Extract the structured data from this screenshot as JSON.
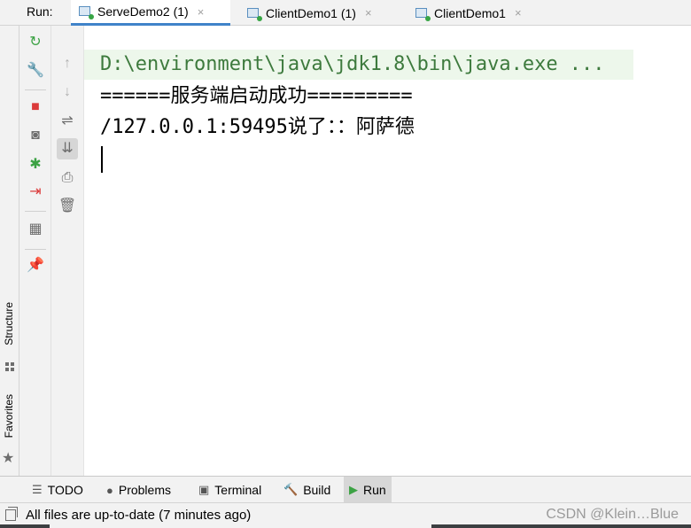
{
  "run_bar": {
    "label": "Run:",
    "tabs": [
      {
        "label": "ServeDemo2 (1)",
        "active": true
      },
      {
        "label": "ClientDemo1 (1)",
        "active": false
      },
      {
        "label": "ClientDemo1",
        "active": false
      }
    ],
    "close_glyph": "×"
  },
  "left_strip": {
    "structure_label": "Structure",
    "favorites_label": "Favorites"
  },
  "toolbar_1": [
    {
      "icon": "rerun-icon",
      "glyph": "↻",
      "color": "#3ca244"
    },
    {
      "icon": "wrench-icon",
      "glyph": "🔧",
      "color": "#6e6e6e"
    },
    {
      "icon": "stop-icon",
      "glyph": "■",
      "color": "#db3b3b"
    },
    {
      "icon": "camera-icon",
      "glyph": "◙",
      "color": "#6e6e6e"
    },
    {
      "icon": "debug-icon",
      "glyph": "✱",
      "color": "#3ca244"
    },
    {
      "icon": "exit-icon",
      "glyph": "⇥",
      "color": "#db3b3b"
    },
    {
      "icon": "layout-icon",
      "glyph": "▦",
      "color": "#6e6e6e"
    },
    {
      "icon": "pin-icon",
      "glyph": "📌",
      "color": "#6e6e6e"
    }
  ],
  "toolbar_2": [
    {
      "icon": "arrow-up-icon",
      "glyph": "↑",
      "color": "#b0b0b0"
    },
    {
      "icon": "arrow-down-icon",
      "glyph": "↓",
      "color": "#b0b0b0"
    },
    {
      "icon": "soft-wrap-icon",
      "glyph": "⇌",
      "color": "#6e6e6e"
    },
    {
      "icon": "scroll-to-end-icon",
      "glyph": "⇊",
      "color": "#6e6e6e"
    },
    {
      "icon": "print-icon",
      "glyph": "⎙",
      "color": "#6e6e6e"
    },
    {
      "icon": "trash-icon",
      "glyph": "🗑",
      "color": "#6e6e6e"
    }
  ],
  "console": {
    "lines": [
      "D:\\environment\\java\\jdk1.8\\bin\\java.exe ...",
      "======服务端启动成功=========",
      "/127.0.0.1:59495说了：：阿萨德"
    ]
  },
  "bottom_tabs": [
    {
      "label": "TODO",
      "icon": "list-icon",
      "glyph": "☰",
      "active": false
    },
    {
      "label": "Problems",
      "icon": "problems-icon",
      "glyph": "●",
      "active": false
    },
    {
      "label": "Terminal",
      "icon": "terminal-icon",
      "glyph": "▣",
      "active": false
    },
    {
      "label": "Build",
      "icon": "hammer-icon",
      "glyph": "🔨",
      "active": false
    },
    {
      "label": "Run",
      "icon": "run-icon",
      "glyph": "▶",
      "active": true
    }
  ],
  "status_bar": {
    "text": "All files are up-to-date (7 minutes ago)",
    "watermark": "CSDN @Klein…Blue"
  },
  "colors": {
    "accent": "#4083c9",
    "console_cmd_bg": "#edf7eb",
    "console_cmd_fg": "#3d7a3d"
  }
}
